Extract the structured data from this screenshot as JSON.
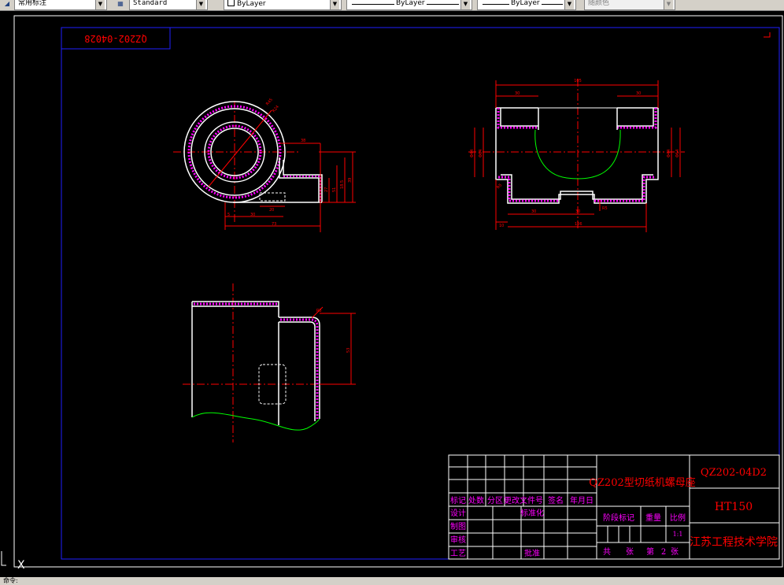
{
  "toolbar": {
    "dimstyle": "常用标注",
    "textstyle": "Standard",
    "layer": "ByLayer",
    "linetype": "ByLayer",
    "lineweight": "ByLayer",
    "color": "随颜色"
  },
  "drawing": {
    "frame_code_mirrored": "QZ202-04028",
    "ucs_label": "X"
  },
  "title_block": {
    "part_name": "QZ202型切纸机螺母座",
    "drawing_number": "QZ202-04D2",
    "material": "HT150",
    "company": "江苏工程技术学院",
    "rev_headers": [
      "标记",
      "处数",
      "分区",
      "更改文件号",
      "签名",
      "年月日"
    ],
    "row_design": "设计",
    "row_standardize": "标准化",
    "row_draw": "制图",
    "row_review": "审核",
    "row_process": "工艺",
    "row_approve": "批准",
    "stage_mark": "阶段标记",
    "weight": "重量",
    "scale_label": "比例",
    "scale_value": "1:1",
    "sheet_total_prefix": "共",
    "sheet_total_suffix": "张",
    "sheet_no_prefix": "第",
    "sheet_no": "2",
    "sheet_no_suffix": "张"
  },
  "dimensions": {
    "top_view": [
      "R45",
      "R24",
      "38",
      "5",
      "30",
      "20",
      "73",
      "27",
      "51",
      "18.5",
      "39"
    ],
    "front_view": [
      "105",
      "30",
      "30",
      "Φ44",
      "Φ64",
      "Φ44",
      "Φ64",
      "R5",
      "30",
      "30",
      "10",
      "106",
      "R5"
    ],
    "side_view": [
      "R5",
      "53"
    ]
  },
  "colors": {
    "background": "#000000",
    "outline": "#ffffff",
    "center_line": "#ff0000",
    "dimension": "#ff0000",
    "hatch": "#ff00ff",
    "break_line": "#00ff00",
    "frame": "#2020ff",
    "title_text": "#ff0000",
    "label_text": "#ff00ff"
  },
  "command_line": "命令:"
}
